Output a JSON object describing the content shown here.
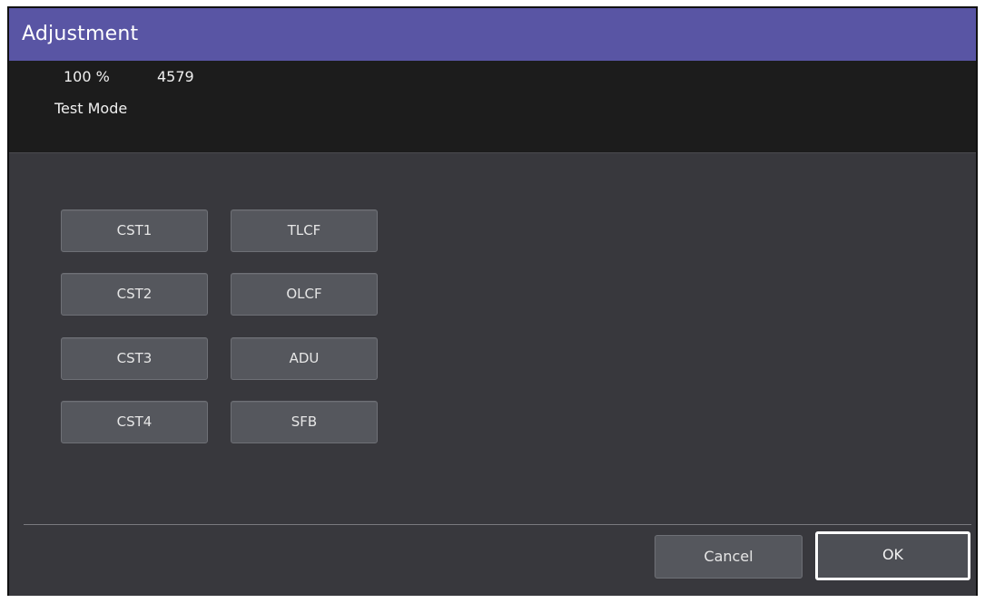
{
  "window": {
    "title": "Adjustment"
  },
  "status": {
    "zoom": "100 %",
    "counter": "4579",
    "mode": "Test Mode"
  },
  "trays": {
    "left": [
      "CST1",
      "CST2",
      "CST3",
      "CST4"
    ],
    "right": [
      "TLCF",
      "OLCF",
      "ADU",
      "SFB"
    ]
  },
  "footer": {
    "cancel_label": "Cancel",
    "ok_label": "OK"
  },
  "colors": {
    "title_bar": "#5955a4",
    "status_panel": "#1c1c1c",
    "body": "#38383d",
    "button": "#55575d"
  }
}
